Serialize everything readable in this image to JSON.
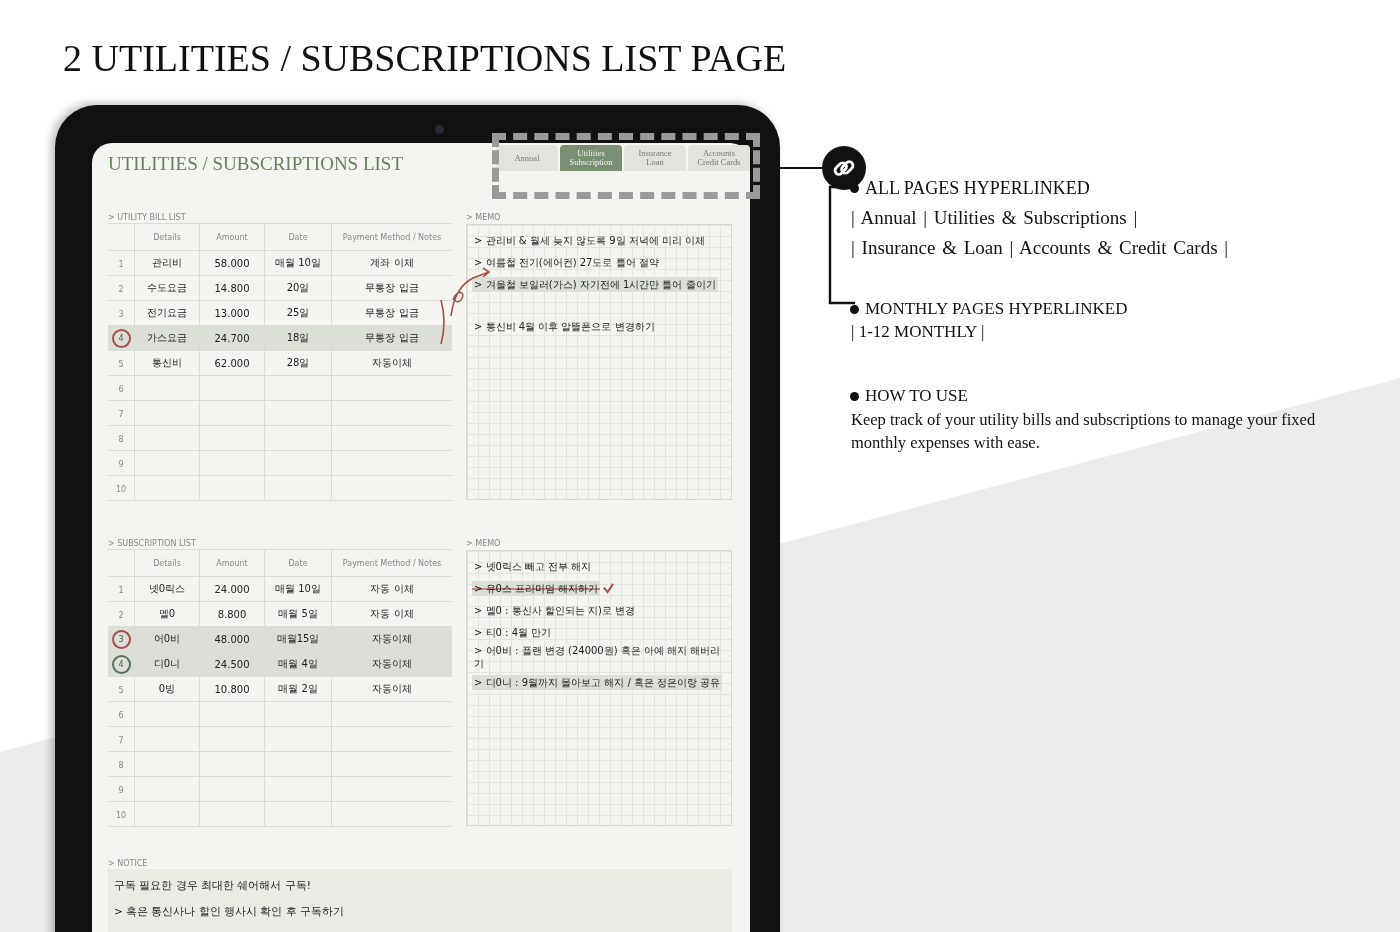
{
  "page_title": "2 UTILITIES / SUBSCRIPTIONS LIST PAGE",
  "planner": {
    "title": "UTILITIES / SUBSCRIPTIONS LIST",
    "tabs": [
      {
        "label": "Annual",
        "selected": false
      },
      {
        "label": "Utilities\nSubscription",
        "selected": true
      },
      {
        "label": "Insurance\nLoan",
        "selected": false
      },
      {
        "label": "Accounts\nCredit Cards",
        "selected": false
      }
    ],
    "utility_list": {
      "label": "> UTILITY BILL LIST",
      "columns": [
        "Details",
        "Amount",
        "Date",
        "Payment Method / Notes"
      ],
      "rows": [
        {
          "number": "1",
          "details": "관리비",
          "amount": "58.000",
          "date": "매월 10일",
          "payment": "계좌 이체",
          "highlighted": false
        },
        {
          "number": "2",
          "details": "수도요금",
          "amount": "14.800",
          "date": "20일",
          "payment": "무통장 입금",
          "highlighted": false
        },
        {
          "number": "3",
          "details": "전기요금",
          "amount": "13.000",
          "date": "25일",
          "payment": "무통장 입금",
          "highlighted": false
        },
        {
          "number": "4",
          "details": "가스요금",
          "amount": "24.700",
          "date": "18일",
          "payment": "무통장 입금",
          "highlighted": true,
          "color": "#a0524b"
        },
        {
          "number": "5",
          "details": "통신비",
          "amount": "62.000",
          "date": "28일",
          "payment": "자동이체",
          "highlighted": false
        },
        {
          "number": "6",
          "highlighted": false
        },
        {
          "number": "7",
          "highlighted": false
        },
        {
          "number": "8",
          "highlighted": false
        },
        {
          "number": "9",
          "highlighted": false
        },
        {
          "number": "10",
          "highlighted": false
        }
      ]
    },
    "utility_memo": {
      "label": "> MEMO",
      "items": [
        {
          "text": "> 관리비 & 월세 늦지 않도록 9일 저녁에 미리 이체",
          "highlighted": false,
          "struck": false,
          "gap_before": false
        },
        {
          "text": "> 여름철 전기(에어컨) 27도로 틀어 절약",
          "highlighted": false,
          "struck": false,
          "gap_before": false
        },
        {
          "text": "> 겨울철 보일러(가스) 자기전에 1시간만 틀어 줄이기",
          "highlighted": true,
          "struck": false,
          "gap_before": false
        },
        {
          "text": "> 통신비 4월 이후 알뜰폰으로 변경하기",
          "highlighted": false,
          "struck": false,
          "gap_before": true
        }
      ]
    },
    "subscription_list": {
      "label": "> SUBSCRIPTION LIST",
      "columns": [
        "Details",
        "Amount",
        "Date",
        "Payment Method / Notes"
      ],
      "rows": [
        {
          "number": "1",
          "details": "넷0릭스",
          "amount": "24.000",
          "date": "매월 10일",
          "payment": "자동 이체",
          "highlighted": false
        },
        {
          "number": "2",
          "details": "멜0",
          "amount": "8.800",
          "date": "매월 5일",
          "payment": "자동 이체",
          "highlighted": false
        },
        {
          "number": "3",
          "details": "어0비",
          "amount": "48.000",
          "date": "매월15일",
          "payment": "자동이체",
          "highlighted": true,
          "color": "#a0524b"
        },
        {
          "number": "4",
          "details": "디0니",
          "amount": "24.500",
          "date": "매월 4일",
          "payment": "자동이체",
          "highlighted": true,
          "color": "#5b7459"
        },
        {
          "number": "5",
          "details": "0빙",
          "amount": "10.800",
          "date": "매월 2일",
          "payment": "자동이체",
          "highlighted": false
        },
        {
          "number": "6",
          "highlighted": false
        },
        {
          "number": "7",
          "highlighted": false
        },
        {
          "number": "8",
          "highlighted": false
        },
        {
          "number": "9",
          "highlighted": false
        },
        {
          "number": "10",
          "highlighted": false
        }
      ]
    },
    "subscription_memo": {
      "label": "> MEMO",
      "items": [
        {
          "text": "> 넷0릭스 빼고 전부 해지",
          "highlighted": false,
          "struck": false,
          "gap_before": false
        },
        {
          "text": "> 유0스 프리미엄 해지하기",
          "highlighted": true,
          "struck": true,
          "gap_before": false
        },
        {
          "text": "> 멜0 : 통신사 할인되는 지)로 변경",
          "highlighted": false,
          "struck": false,
          "gap_before": false
        },
        {
          "text": "> 티0 : 4월 만기",
          "highlighted": false,
          "struck": false,
          "gap_before": false
        },
        {
          "text": "> 어0비 : 플랜 변경 (24000원) 혹은 아예 해지 해버리기",
          "highlighted": false,
          "struck": false,
          "gap_before": false
        },
        {
          "text": "> 디0니 : 9월까지 몰아보고 해지 / 혹은 정은이랑 공유",
          "highlighted": true,
          "struck": false,
          "gap_before": false
        }
      ]
    },
    "notice": {
      "label": "> NOTICE",
      "lines": [
        "구독 필요한 경우 최대한 쉐어해서 구독!",
        "> 혹은 통신사나 할인 행사시 확인 후  구독하기"
      ]
    }
  },
  "features": {
    "links_heading": "ALL PAGES HYPERLINKED",
    "links_lines": [
      "|  Annual  |  Utilities & Subscriptions  |",
      "|  Insurance & Loan  |  Accounts & Credit Cards  |"
    ],
    "monthly_heading": "MONTHLY PAGES HYPERLINKED",
    "monthly_line": "| 1-12 MONTHLY |",
    "how_to_heading": "HOW TO USE",
    "how_to_text": "Keep track of your utility bills and subscriptions to manage your fixed monthly expenses with ease."
  }
}
